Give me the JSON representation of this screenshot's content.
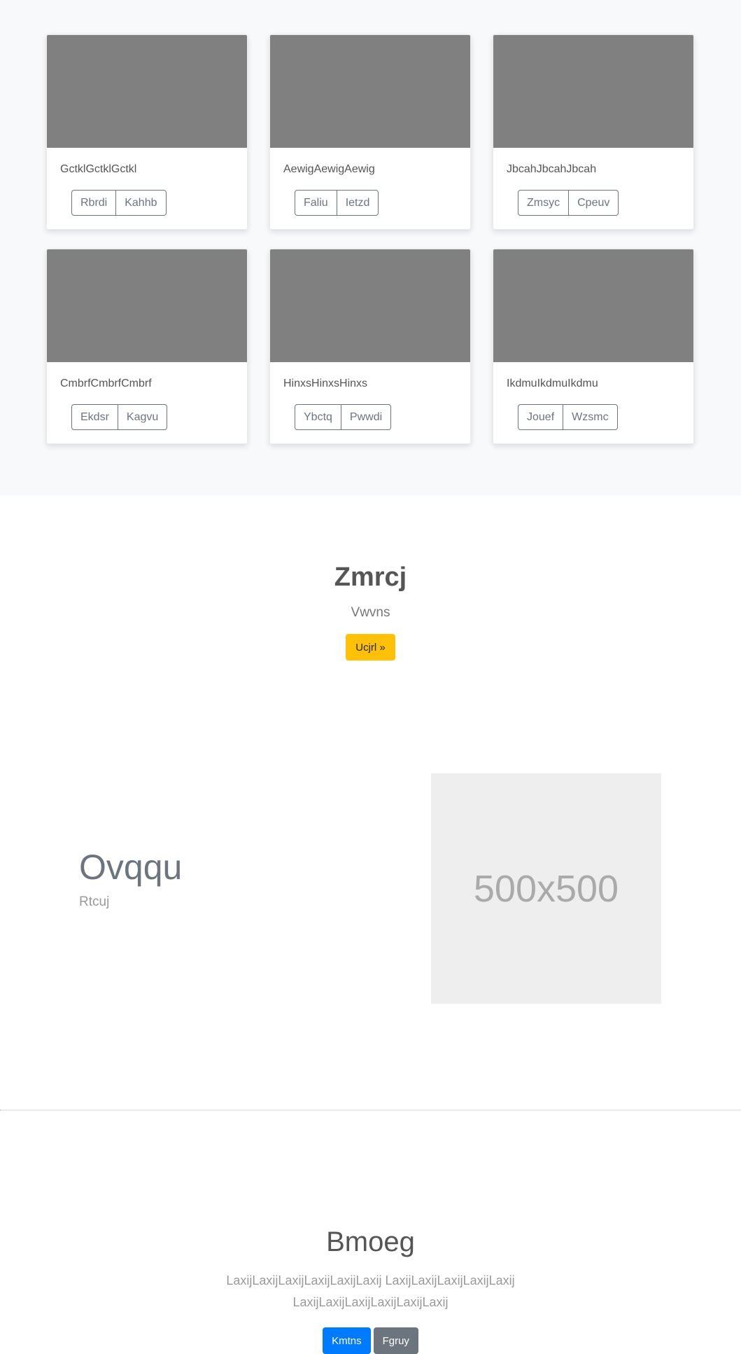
{
  "cards": [
    {
      "text": "GctklGctklGctkl",
      "buttons": [
        "Rbrdi",
        "Kahhb"
      ]
    },
    {
      "text": "AewigAewigAewig",
      "buttons": [
        "Faliu",
        "Ietzd"
      ]
    },
    {
      "text": "JbcahJbcahJbcah",
      "buttons": [
        "Zmsyc",
        "Cpeuv"
      ]
    },
    {
      "text": "CmbrfCmbrfCmbrf",
      "buttons": [
        "Ekdsr",
        "Kagvu"
      ]
    },
    {
      "text": "HinxsHinxsHinxs",
      "buttons": [
        "Ybctq",
        "Pwwdi"
      ]
    },
    {
      "text": "IkdmuIkdmuIkdmu",
      "buttons": [
        "Jouef",
        "Wzsmc"
      ]
    }
  ],
  "cta": {
    "title": "Zmrcj",
    "subtitle": "Vwvns",
    "button_label": "Ucjrl »",
    "button_color": "#ffc107"
  },
  "feature": {
    "title": "Ovqqu",
    "subtitle": "Rtcuj",
    "image_label": "500x500"
  },
  "jumbotron": {
    "title": "Bmoeg",
    "lead": "LaxijLaxijLaxijLaxijLaxijLaxij LaxijLaxijLaxijLaxijLaxij LaxijLaxijLaxijLaxijLaxijLaxij",
    "primary_label": "Kmtns",
    "secondary_label": "Fgruy",
    "primary_color": "#007bff",
    "secondary_color": "#6c757d"
  },
  "colors": {
    "album_background": "#f8f9fa",
    "thumbnail": "#808080",
    "placeholder": "#eeeeee"
  }
}
